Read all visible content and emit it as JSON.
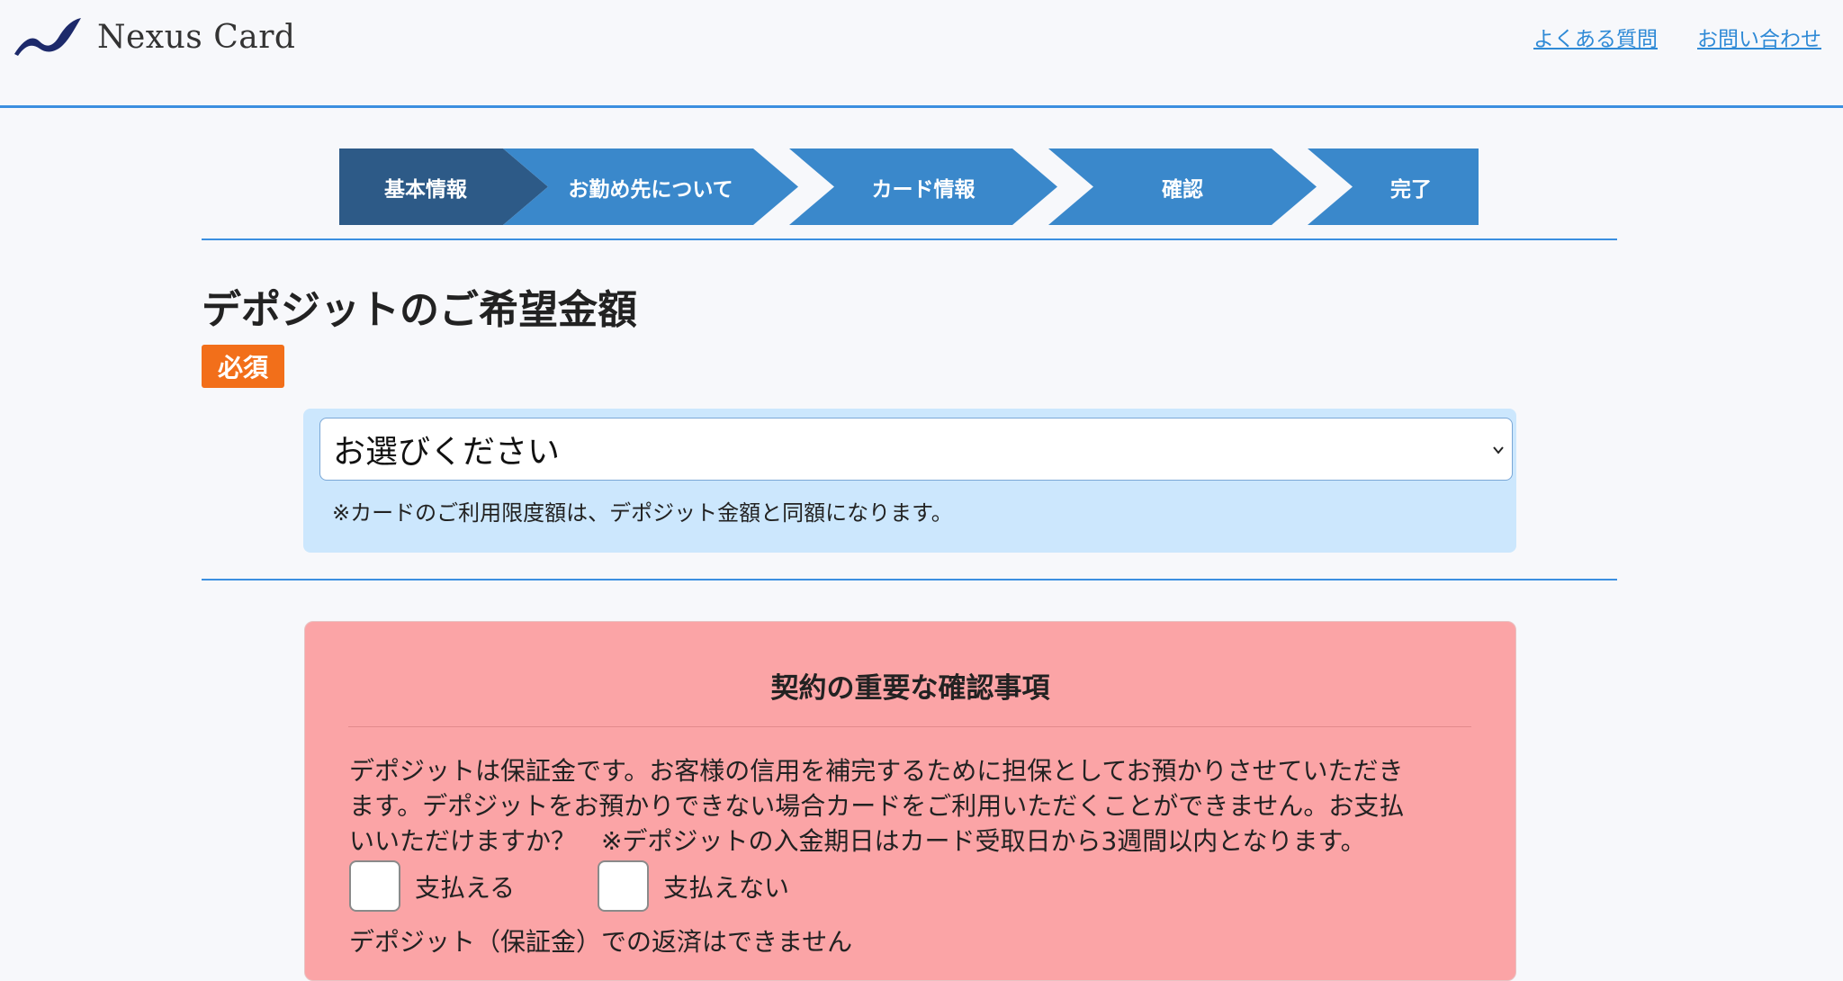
{
  "header": {
    "logo_text": "Nexus Card",
    "links": [
      "よくある質問",
      "お問い合わせ"
    ],
    "accent_color": "#3b8fe0"
  },
  "stepper": {
    "steps": [
      "基本情報",
      "お勤め先について",
      "カード情報",
      "確認",
      "完了"
    ],
    "active_index": 0,
    "active_color": "#2d5a87",
    "inactive_color": "#3a88cb"
  },
  "deposit": {
    "title": "デポジットのご希望金額",
    "required_badge": "必須",
    "select_value": "お選びください",
    "note": "※カードのご利用限度額は、デポジット金額と同額になります。"
  },
  "contract": {
    "title": "契約の重要な確認事項",
    "lines": [
      "デポジットは保証金です。お客様の信用を補完するために担保としてお預かりさせていただき",
      "ます。デポジットをお預かりできない場合カードをご利用いただくことができません。お支払",
      "いいただけますか？　※デポジットの入金期日はカード受取日から3週間以内となります。"
    ],
    "option_yes": "支払える",
    "option_no": "支払えない",
    "cutoff_text": "デポジット（保証金）での返済はできません"
  }
}
